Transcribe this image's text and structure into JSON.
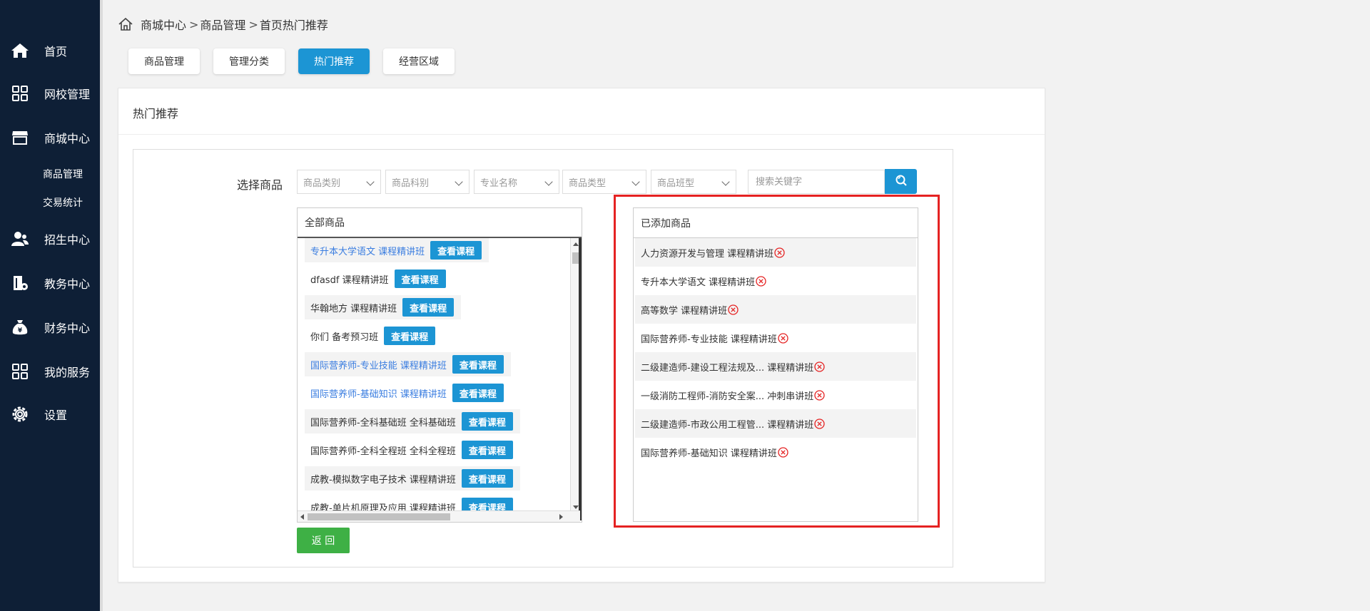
{
  "sidebar": {
    "items": [
      {
        "label": "首页"
      },
      {
        "label": "网校管理"
      },
      {
        "label": "商城中心"
      },
      {
        "label": "招生中心"
      },
      {
        "label": "教务中心"
      },
      {
        "label": "财务中心"
      },
      {
        "label": "我的服务"
      },
      {
        "label": "设置"
      }
    ],
    "sub_items": [
      {
        "label": "商品管理"
      },
      {
        "label": "交易统计"
      }
    ]
  },
  "breadcrumb": {
    "items": [
      "商城中心",
      "商品管理",
      "首页热门推荐"
    ],
    "separator": ">"
  },
  "tabs": [
    {
      "label": "商品管理"
    },
    {
      "label": "管理分类"
    },
    {
      "label": "热门推荐",
      "active": true
    },
    {
      "label": "经营区域"
    }
  ],
  "panel": {
    "title": "热门推荐"
  },
  "filters": {
    "label": "选择商品",
    "selects": [
      {
        "label": "商品类别"
      },
      {
        "label": "商品科别"
      },
      {
        "label": "专业名称"
      },
      {
        "label": "商品类型"
      },
      {
        "label": "商品班型"
      }
    ],
    "search_placeholder": "搜索关键字"
  },
  "all_goods": {
    "title": "全部商品",
    "view_label": "查看课程",
    "items": [
      {
        "name": "专升本大学语文 课程精讲班",
        "link": true
      },
      {
        "name": "dfasdf 课程精讲班",
        "link": false
      },
      {
        "name": "华翰地方 课程精讲班",
        "link": false
      },
      {
        "name": "你们 备考预习班",
        "link": false
      },
      {
        "name": "国际营养师-专业技能 课程精讲班",
        "link": true
      },
      {
        "name": "国际营养师-基础知识 课程精讲班",
        "link": true
      },
      {
        "name": "国际营养师-全科基础班 全科基础班",
        "link": false
      },
      {
        "name": "国际营养师-全科全程班 全科全程班",
        "link": false
      },
      {
        "name": "成教-模拟数字电子技术 课程精讲班",
        "link": false
      },
      {
        "name": "成教-单片机原理及应用 课程精讲班",
        "link": false
      }
    ]
  },
  "added_goods": {
    "title": "已添加商品",
    "items": [
      {
        "name": "人力资源开发与管理 课程精讲班"
      },
      {
        "name": "专升本大学语文 课程精讲班"
      },
      {
        "name": "高等数学 课程精讲班"
      },
      {
        "name": "国际营养师-专业技能 课程精讲班"
      },
      {
        "name": "二级建造师-建设工程法规及... 课程精讲班"
      },
      {
        "name": "一级消防工程师-消防安全案... 冲刺串讲班"
      },
      {
        "name": "二级建造师-市政公用工程管... 课程精讲班"
      },
      {
        "name": "国际营养师-基础知识 课程精讲班"
      }
    ]
  },
  "back_label": "返 回",
  "colors": {
    "sidebar_bg": "#0e1f36",
    "primary": "#1c95d4",
    "success": "#3eb045",
    "highlight": "#e52222",
    "link": "#3a7de0"
  }
}
